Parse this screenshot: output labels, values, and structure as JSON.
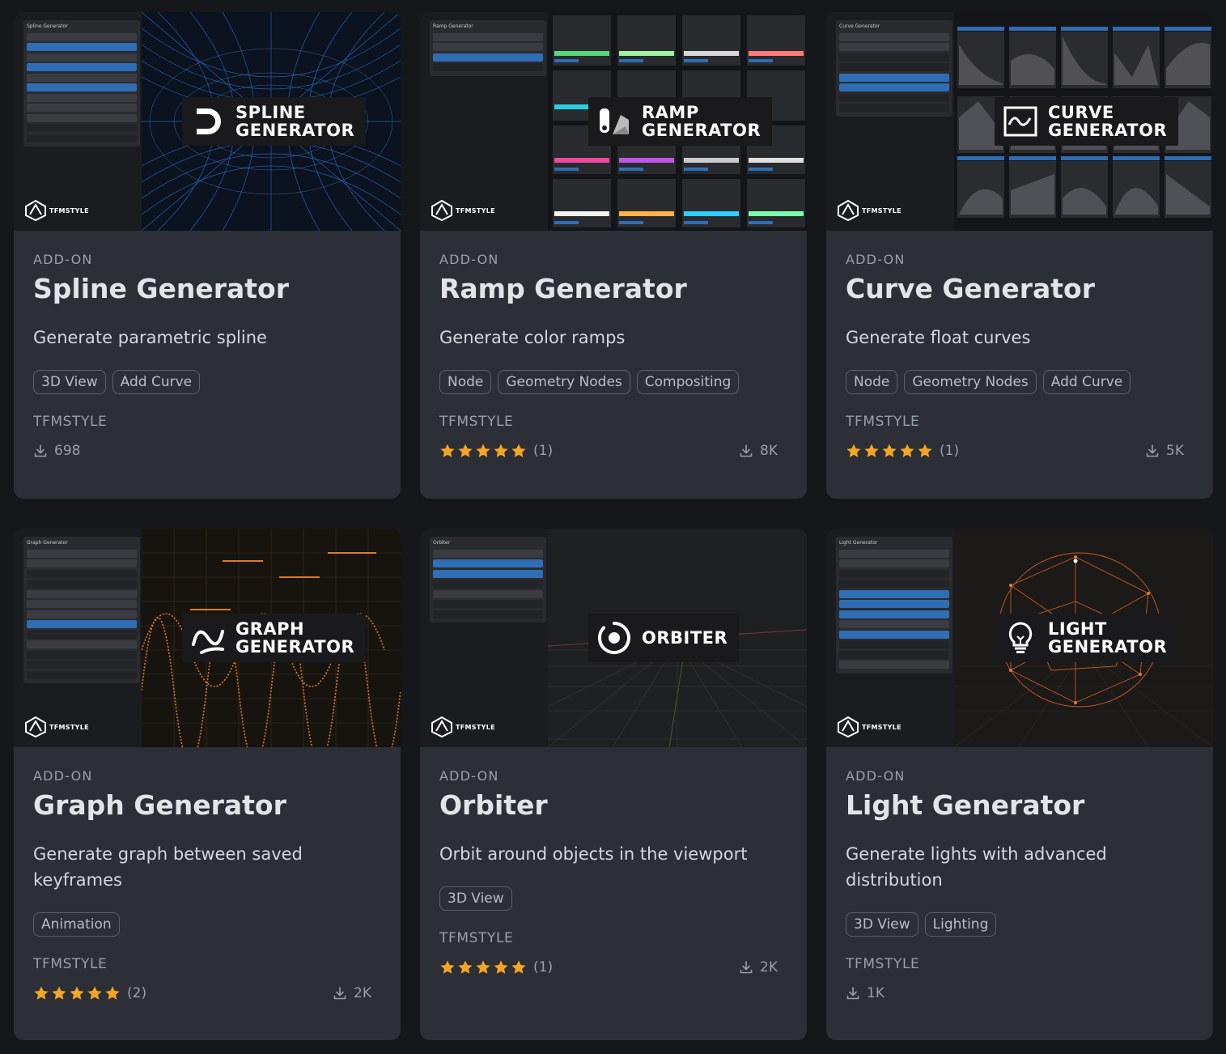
{
  "cards": [
    {
      "badge": "SPLINE\nGENERATOR",
      "brand": "TFMSTYLE",
      "panel_title": "Spline Generator",
      "category": "ADD-ON",
      "title": "Spline Generator",
      "desc": "Generate parametric spline",
      "tags": [
        "3D View",
        "Add Curve"
      ],
      "author": "TFMSTYLE",
      "rating": null,
      "rating_count": "",
      "downloads": "698",
      "accent": "#3b82d6"
    },
    {
      "badge": "RAMP\nGENERATOR",
      "brand": "TFMSTYLE",
      "panel_title": "Ramp Generator",
      "category": "ADD-ON",
      "title": "Ramp Generator",
      "desc": "Generate color ramps",
      "tags": [
        "Node",
        "Geometry Nodes",
        "Compositing"
      ],
      "author": "TFMSTYLE",
      "rating": 5,
      "rating_count": "(1)",
      "downloads": "8K",
      "accent": "#3b82d6"
    },
    {
      "badge": "CURVE\nGENERATOR",
      "brand": "TFMSTYLE",
      "panel_title": "Curve Generator",
      "category": "ADD-ON",
      "title": "Curve Generator",
      "desc": "Generate float curves",
      "tags": [
        "Node",
        "Geometry Nodes",
        "Add Curve"
      ],
      "author": "TFMSTYLE",
      "rating": 5,
      "rating_count": "(1)",
      "downloads": "5K",
      "accent": "#3b82d6"
    },
    {
      "badge": "GRAPH\nGENERATOR",
      "brand": "TFMSTYLE",
      "panel_title": "Graph Generator",
      "category": "ADD-ON",
      "title": "Graph Generator",
      "desc": "Generate graph between saved keyframes",
      "tags": [
        "Animation"
      ],
      "author": "TFMSTYLE",
      "rating": 5,
      "rating_count": "(2)",
      "downloads": "2K",
      "accent": "#e07a1f"
    },
    {
      "badge": "ORBITER",
      "brand": "TFMSTYLE",
      "panel_title": "Orbiter",
      "category": "ADD-ON",
      "title": "Orbiter",
      "desc": "Orbit around objects in the viewport",
      "tags": [
        "3D View"
      ],
      "author": "TFMSTYLE",
      "rating": 5,
      "rating_count": "(1)",
      "downloads": "2K",
      "accent": "#3b82d6"
    },
    {
      "badge": "LIGHT\nGENERATOR",
      "brand": "TFMSTYLE",
      "panel_title": "Light Generator",
      "category": "ADD-ON",
      "title": "Light Generator",
      "desc": "Generate lights with advanced distribution",
      "tags": [
        "3D View",
        "Lighting"
      ],
      "author": "TFMSTYLE",
      "rating": null,
      "rating_count": "",
      "downloads": "1K",
      "accent": "#d4642a"
    }
  ],
  "icons": {
    "download": "download-icon",
    "star": "star-icon"
  },
  "colors": {
    "background": "#16171a",
    "card": "#2c2f35",
    "star": "#f4a623",
    "text_muted": "#9aa0a8"
  }
}
